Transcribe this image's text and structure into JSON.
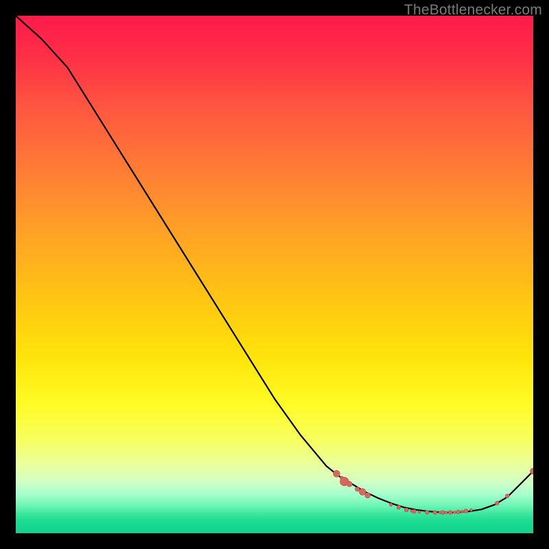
{
  "watermark": "TheBottlenecker.com",
  "colors": {
    "curve": "#000000",
    "marker_fill": "#d46a5f",
    "marker_stroke": "#b64f47",
    "background": "#000000"
  },
  "chart_data": {
    "type": "line",
    "title": "",
    "xlabel": "",
    "ylabel": "",
    "xlim": [
      0,
      100
    ],
    "ylim": [
      0,
      100
    ],
    "x": [
      0,
      5,
      10,
      15,
      20,
      25,
      30,
      35,
      40,
      45,
      50,
      55,
      60,
      62.5,
      65,
      67.5,
      70,
      72.5,
      75,
      77.5,
      80,
      82.5,
      85,
      87.5,
      90,
      92.5,
      95,
      100
    ],
    "y": [
      100,
      95.5,
      90,
      82,
      74,
      66,
      58,
      50,
      42,
      34,
      26,
      19,
      13,
      11,
      9.5,
      8,
      6.8,
      5.8,
      5,
      4.5,
      4.2,
      4,
      4,
      4.2,
      4.6,
      5.5,
      7,
      12
    ],
    "markers": [
      {
        "x": 62,
        "y": 11.5,
        "r": 3.5
      },
      {
        "x": 63,
        "y": 10.7,
        "r": 1.8
      },
      {
        "x": 63.5,
        "y": 10,
        "r": 4.5
      },
      {
        "x": 64.5,
        "y": 9.5,
        "r": 2.8
      },
      {
        "x": 66,
        "y": 8.5,
        "r": 2.3
      },
      {
        "x": 67,
        "y": 8,
        "r": 3.5
      },
      {
        "x": 68,
        "y": 7.3,
        "r": 2.8
      },
      {
        "x": 72.5,
        "y": 5.5,
        "r": 1.6
      },
      {
        "x": 74,
        "y": 5,
        "r": 2.1
      },
      {
        "x": 75.5,
        "y": 4.5,
        "r": 2.1
      },
      {
        "x": 76.5,
        "y": 4.3,
        "r": 1.4
      },
      {
        "x": 77,
        "y": 4.2,
        "r": 2.1
      },
      {
        "x": 78,
        "y": 4.1,
        "r": 1.4
      },
      {
        "x": 79.5,
        "y": 4.05,
        "r": 2.1
      },
      {
        "x": 81,
        "y": 4,
        "r": 2.1
      },
      {
        "x": 82,
        "y": 4,
        "r": 1.4
      },
      {
        "x": 82.5,
        "y": 4,
        "r": 2.1
      },
      {
        "x": 83.2,
        "y": 4,
        "r": 1.4
      },
      {
        "x": 84,
        "y": 4,
        "r": 2.1
      },
      {
        "x": 84.8,
        "y": 4.05,
        "r": 1.4
      },
      {
        "x": 85.5,
        "y": 4.1,
        "r": 2.1
      },
      {
        "x": 86.3,
        "y": 4.2,
        "r": 1.4
      },
      {
        "x": 87,
        "y": 4.3,
        "r": 2.1
      },
      {
        "x": 88,
        "y": 4.5,
        "r": 1.4
      },
      {
        "x": 93,
        "y": 5.8,
        "r": 2.1
      },
      {
        "x": 95,
        "y": 7.2,
        "r": 2.1
      },
      {
        "x": 100,
        "y": 12,
        "r": 3.2
      }
    ]
  }
}
